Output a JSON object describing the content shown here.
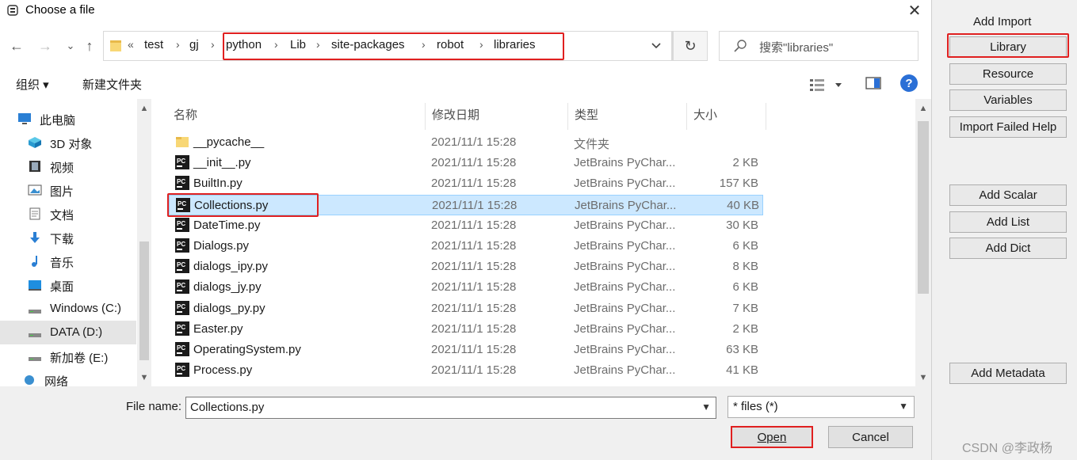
{
  "dialog": {
    "title": "Choose a file",
    "close_glyph": "✕"
  },
  "nav": {
    "back": "←",
    "forward": "→",
    "recent": "⌄",
    "up": "↑"
  },
  "address": {
    "overflow": "«",
    "crumbs": [
      "test",
      "gj",
      "python",
      "Lib",
      "site-packages",
      "robot",
      "libraries"
    ],
    "separator": "›"
  },
  "search": {
    "placeholder": "搜索\"libraries\""
  },
  "toolbar": {
    "organize": "组织 ▾",
    "new_folder": "新建文件夹"
  },
  "sidebar": {
    "items": [
      {
        "label": "此电脑",
        "icon": "computer-icon"
      },
      {
        "label": "3D 对象",
        "icon": "3d-objects-icon"
      },
      {
        "label": "视频",
        "icon": "video-icon"
      },
      {
        "label": "图片",
        "icon": "pictures-icon"
      },
      {
        "label": "文档",
        "icon": "documents-icon"
      },
      {
        "label": "下载",
        "icon": "download-icon"
      },
      {
        "label": "音乐",
        "icon": "music-icon"
      },
      {
        "label": "桌面",
        "icon": "desktop-icon"
      },
      {
        "label": "Windows (C:)",
        "icon": "drive-icon"
      },
      {
        "label": "DATA (D:)",
        "icon": "drive-icon",
        "selected": true
      },
      {
        "label": "新加卷 (E:)",
        "icon": "drive-icon"
      },
      {
        "label": "网络",
        "icon": "network-icon"
      }
    ]
  },
  "columns": [
    "名称",
    "修改日期",
    "类型",
    "大小"
  ],
  "files": [
    {
      "name": "__pycache__",
      "date": "2021/11/1 15:28",
      "type": "文件夹",
      "size": "",
      "kind": "folder"
    },
    {
      "name": "__init__.py",
      "date": "2021/11/1 15:28",
      "type": "JetBrains PyChar...",
      "size": "2 KB",
      "kind": "py"
    },
    {
      "name": "BuiltIn.py",
      "date": "2021/11/1 15:28",
      "type": "JetBrains PyChar...",
      "size": "157 KB",
      "kind": "py"
    },
    {
      "name": "Collections.py",
      "date": "2021/11/1 15:28",
      "type": "JetBrains PyChar...",
      "size": "40 KB",
      "kind": "py",
      "selected": true
    },
    {
      "name": "DateTime.py",
      "date": "2021/11/1 15:28",
      "type": "JetBrains PyChar...",
      "size": "30 KB",
      "kind": "py"
    },
    {
      "name": "Dialogs.py",
      "date": "2021/11/1 15:28",
      "type": "JetBrains PyChar...",
      "size": "6 KB",
      "kind": "py"
    },
    {
      "name": "dialogs_ipy.py",
      "date": "2021/11/1 15:28",
      "type": "JetBrains PyChar...",
      "size": "8 KB",
      "kind": "py"
    },
    {
      "name": "dialogs_jy.py",
      "date": "2021/11/1 15:28",
      "type": "JetBrains PyChar...",
      "size": "6 KB",
      "kind": "py"
    },
    {
      "name": "dialogs_py.py",
      "date": "2021/11/1 15:28",
      "type": "JetBrains PyChar...",
      "size": "7 KB",
      "kind": "py"
    },
    {
      "name": "Easter.py",
      "date": "2021/11/1 15:28",
      "type": "JetBrains PyChar...",
      "size": "2 KB",
      "kind": "py"
    },
    {
      "name": "OperatingSystem.py",
      "date": "2021/11/1 15:28",
      "type": "JetBrains PyChar...",
      "size": "63 KB",
      "kind": "py"
    },
    {
      "name": "Process.py",
      "date": "2021/11/1 15:28",
      "type": "JetBrains PyChar...",
      "size": "41 KB",
      "kind": "py"
    }
  ],
  "filename": {
    "label": "File name:",
    "value": "Collections.py"
  },
  "filter": {
    "value": "* files (*)"
  },
  "buttons": {
    "open": "Open",
    "cancel": "Cancel"
  },
  "right_panel": {
    "header": "Add Import",
    "buttons": [
      "Library",
      "Resource",
      "Variables",
      "Import Failed Help",
      "Add Scalar",
      "Add List",
      "Add Dict",
      "Add Metadata"
    ]
  },
  "watermark": "CSDN @李政杨",
  "colors": {
    "highlight": "#e02020",
    "selection": "#cce8ff",
    "pycharm_icon": "#1b1b1b"
  }
}
